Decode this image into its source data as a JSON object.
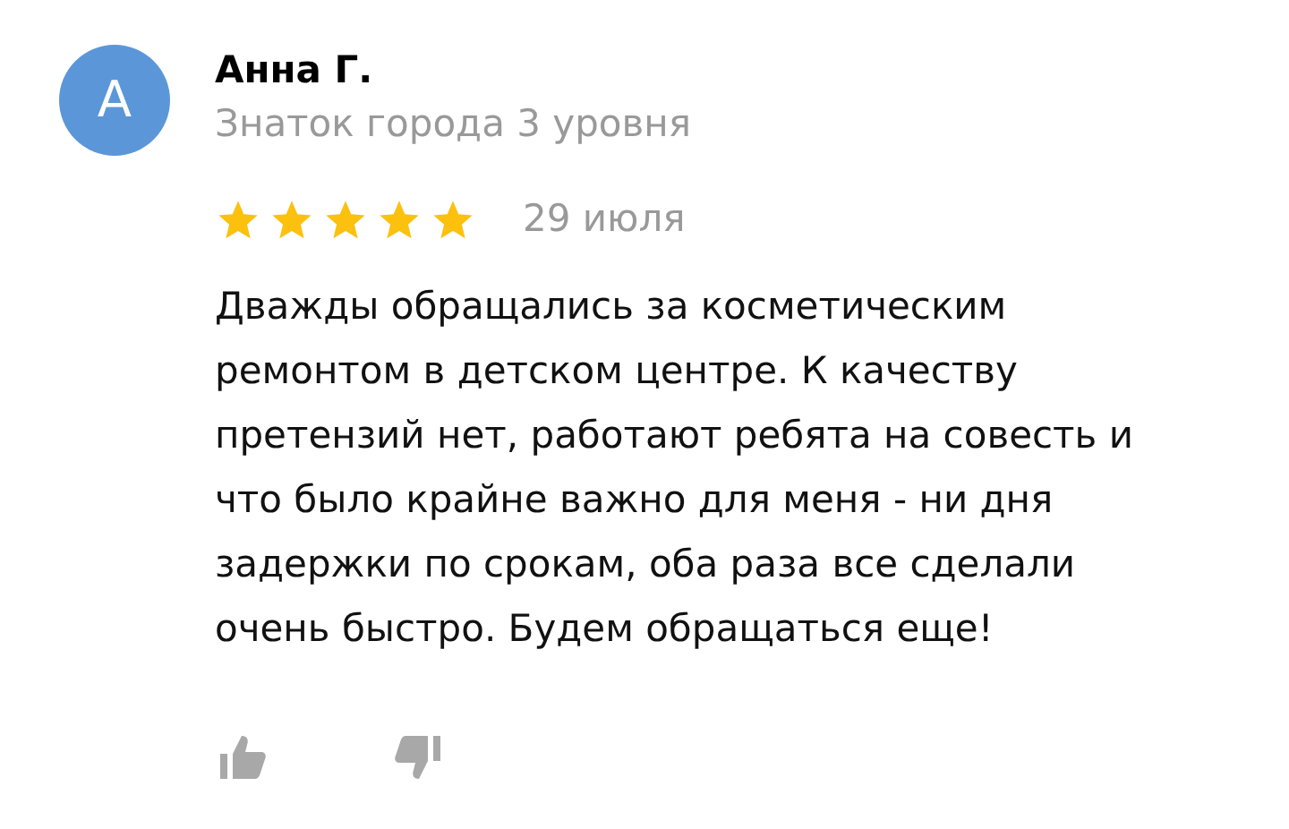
{
  "review": {
    "avatar_letter": "А",
    "author": "Анна Г.",
    "author_level": "Знаток города 3 уровня",
    "stars": 5,
    "date": "29 июля",
    "text": "Дважды обращались за косметическим ремонтом в детском центре. К качеству претензий нет, работают ребята на совесть и что было крайне важно для меня - ни дня задержки по срокам, оба раза все сделали очень быстро. Будем обращаться еще!"
  }
}
